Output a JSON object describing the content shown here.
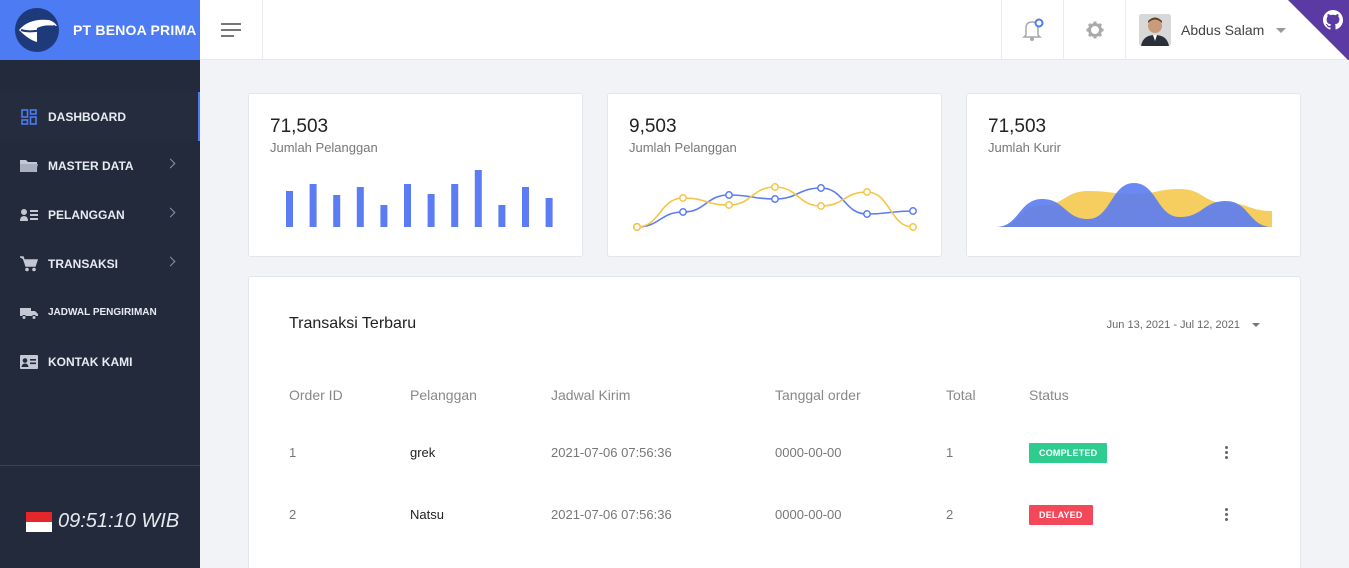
{
  "brand": {
    "name": "PT BENOA PRIMA"
  },
  "topbar": {
    "user_name": "Abdus Salam",
    "icons": [
      "menu-icon",
      "bell-icon",
      "gear-icon",
      "github-icon"
    ]
  },
  "sidebar": {
    "items": [
      {
        "label": "DASHBOARD",
        "icon": "dashboard-icon",
        "active": true
      },
      {
        "label": "MASTER DATA",
        "icon": "folder-icon",
        "chevron": true
      },
      {
        "label": "PELANGGAN",
        "icon": "customers-icon",
        "chevron": true
      },
      {
        "label": "TRANSAKSI",
        "icon": "cart-icon",
        "chevron": true
      },
      {
        "label": "JADWAL PENGIRIMAN",
        "icon": "truck-icon"
      },
      {
        "label": "KONTAK KAMI",
        "icon": "contact-card-icon"
      }
    ],
    "clock": "09:51:10 WIB"
  },
  "stats": [
    {
      "value": "71,503",
      "label": "Jumlah Pelanggan"
    },
    {
      "value": "9,503",
      "label": "Jumlah Pelanggan"
    },
    {
      "value": "71,503",
      "label": "Jumlah Kurir"
    }
  ],
  "colors": {
    "brand": "#4c7bf3",
    "sidebar": "#232a3b",
    "series_blue": "#5b7cf2",
    "series_yellow": "#f5c544",
    "completed": "#2ecc8f",
    "delayed": "#f2485a"
  },
  "chart_data": [
    {
      "type": "bar",
      "values": [
        36,
        43,
        32,
        40,
        22,
        43,
        33,
        43,
        57,
        22,
        40,
        29
      ]
    },
    {
      "type": "line",
      "series": [
        {
          "values": [
            0,
            15,
            32,
            28,
            39,
            13,
            16
          ]
        },
        {
          "values": [
            0,
            29,
            22,
            40,
            21,
            35,
            0
          ]
        }
      ]
    },
    {
      "type": "area",
      "series": [
        {
          "values": [
            0,
            28,
            8,
            44,
            10,
            26,
            0
          ]
        },
        {
          "values": [
            0,
            22,
            36,
            33,
            38,
            24,
            16
          ]
        }
      ]
    }
  ],
  "table": {
    "title": "Transaksi Terbaru",
    "date_range": "Jun 13, 2021 - Jul 12, 2021",
    "headers": [
      "Order ID",
      "Pelanggan",
      "Jadwal Kirim",
      "Tanggal order",
      "Total",
      "Status"
    ],
    "rows": [
      {
        "id": "1",
        "pelanggan": "grek",
        "jadwal": "2021-07-06 07:56:36",
        "tanggal": "0000-00-00",
        "total": "1",
        "status": "COMPLETED"
      },
      {
        "id": "2",
        "pelanggan": "Natsu",
        "jadwal": "2021-07-06 07:56:36",
        "tanggal": "0000-00-00",
        "total": "2",
        "status": "DELAYED"
      }
    ]
  }
}
